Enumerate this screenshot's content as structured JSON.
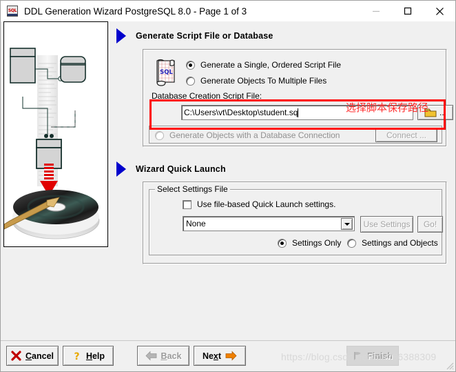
{
  "window": {
    "title": "DDL Generation Wizard PostgreSQL 8.0 - Page 1 of 3",
    "app_icon": "sql-scroll-icon",
    "icon_text": "SQL",
    "controls": {
      "minimize": "minimize-icon",
      "maximize": "maximize-icon",
      "close": "close-icon"
    }
  },
  "illustration": {
    "alt": "database-diagram-to-cd-illustration"
  },
  "sections": {
    "generate": {
      "header": "Generate Script File or Database",
      "icon": "sql-scroll-icon",
      "options": [
        {
          "label": "Generate a Single, Ordered Script File",
          "checked": true,
          "enabled": true
        },
        {
          "label": "Generate Objects To Multiple Files",
          "checked": false,
          "enabled": true
        }
      ],
      "file_label": "Database Creation Script File:",
      "file_value": "C:\\Users\\vt\\Desktop\\student.sq",
      "file_placeholder": "",
      "browse_button": {
        "label": "...",
        "icon": "folder-icon"
      },
      "db_connection": {
        "label": "Generate Objects with a Database Connection",
        "checked": false,
        "enabled": false,
        "button": "Connect ..."
      }
    },
    "quick_launch": {
      "header": "Wizard Quick Launch",
      "group_legend": "Select Settings File",
      "checkbox_label": "Use file-based Quick Launch settings.",
      "checkbox_checked": false,
      "settings_select": {
        "value": "None",
        "options": [
          "None"
        ]
      },
      "use_settings_button": "Use Settings",
      "go_button": "Go!",
      "mode_options": [
        {
          "label": "Settings Only",
          "checked": true
        },
        {
          "label": "Settings and Objects",
          "checked": false
        }
      ]
    }
  },
  "annotation": {
    "text": "选择脚本保存路径",
    "color": "#ff2d2d"
  },
  "footer": {
    "buttons": [
      {
        "name": "cancel",
        "label": "Cancel",
        "icon": "x-icon",
        "enabled": true
      },
      {
        "name": "help",
        "label": "Help",
        "icon": "question-icon",
        "enabled": true
      },
      {
        "name": "back",
        "label": "Back",
        "icon": "arrow-left-icon",
        "enabled": false
      },
      {
        "name": "next",
        "label": "Next",
        "icon": "arrow-right-icon",
        "enabled": true
      },
      {
        "name": "finish",
        "label": "Finish",
        "icon": "flag-icon",
        "enabled": false
      }
    ]
  },
  "watermark": "https://blog.csdn.net/ma286388309"
}
